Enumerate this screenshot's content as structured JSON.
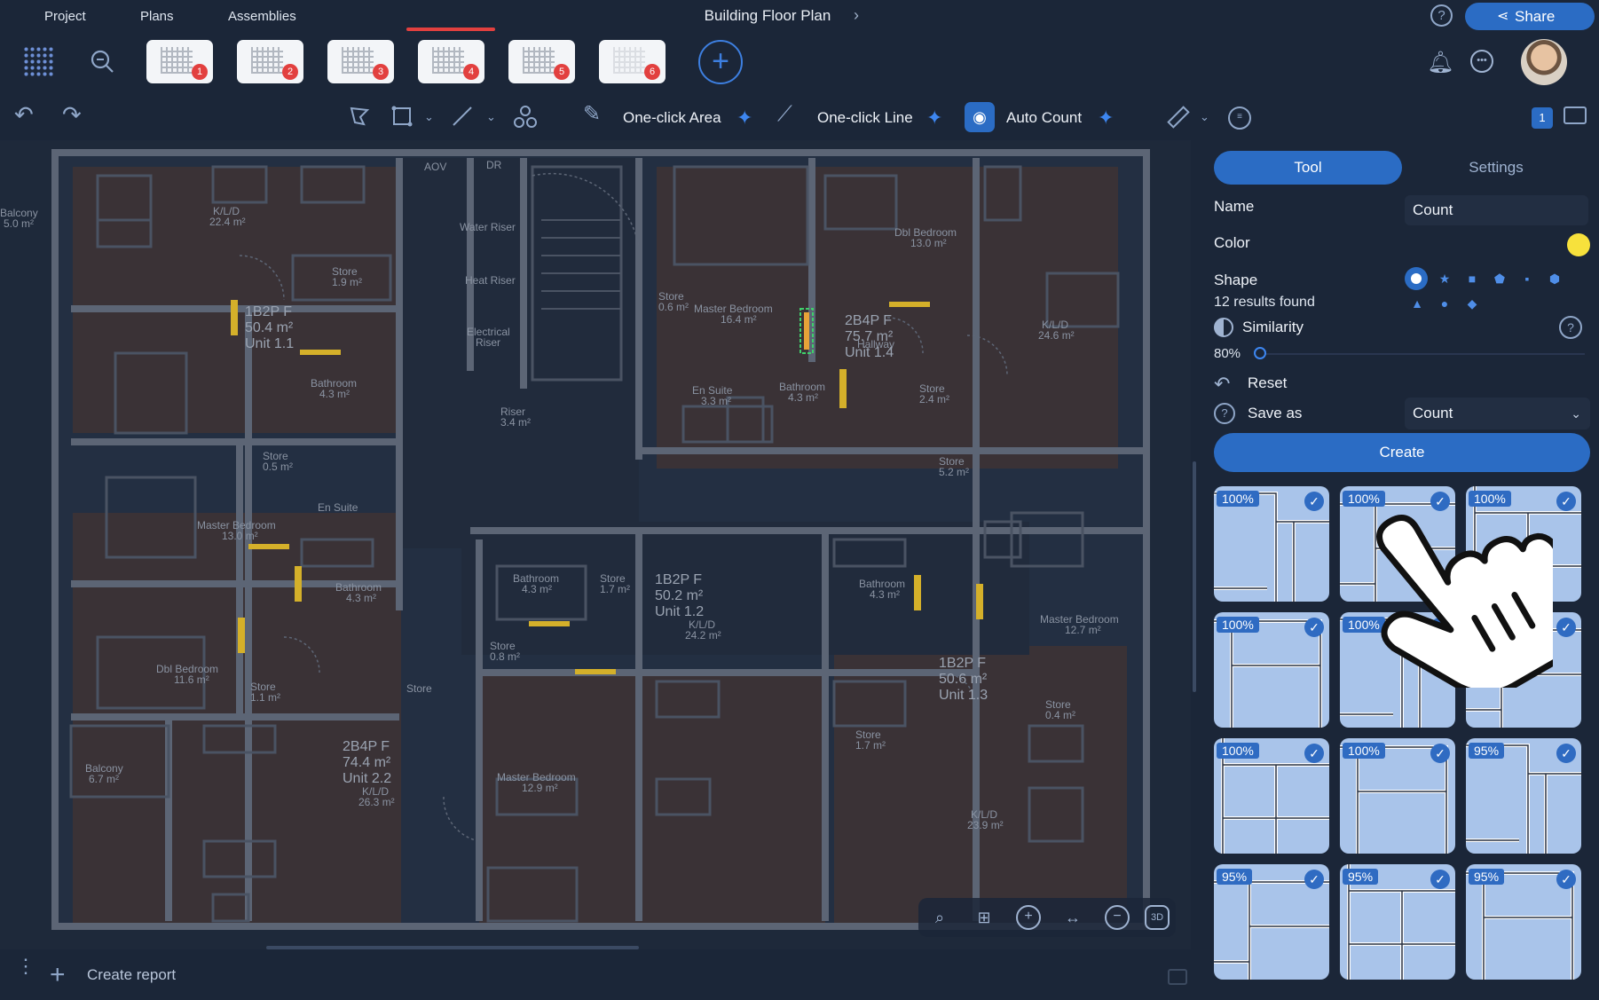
{
  "nav": {
    "tabs": [
      "Project",
      "Plans",
      "Assemblies"
    ],
    "title": "Building Floor Plan",
    "share": "Share"
  },
  "plans": {
    "thumbnails": [
      "1",
      "2",
      "3",
      "4",
      "5",
      "6"
    ],
    "active_index": 3
  },
  "toolbar": {
    "one_click_area": "One-click Area",
    "one_click_line": "One-click Line",
    "auto_count": "Auto Count",
    "page_badge": "1"
  },
  "plan": {
    "labels": {
      "aov": "AOV",
      "dr": "DR",
      "balcony_top": "Balcony",
      "balcony_top_area": "5.0 m²",
      "kld_1": "K/L/D",
      "kld_1_area": "22.4 m²",
      "store_1": "Store",
      "store_1_area": "1.9 m²",
      "bathroom_1": "Bathroom",
      "bathroom_1_area": "4.3 m²",
      "water_riser": "Water Riser",
      "heat_riser": "Heat Riser",
      "electrical_riser_1": "Electrical",
      "electrical_riser_2": "Riser",
      "riser": "Riser",
      "riser_area": "3.4 m²",
      "master_bed_top": "Master Bedroom",
      "master_bed_top_area": "16.4 m²",
      "store_top": "Store",
      "store_top_area": "0.6 m²",
      "dbl_bed_top": "Dbl Bedroom",
      "dbl_bed_top_area": "13.0 m²",
      "en_suite_top": "En Suite",
      "en_suite_top_area": "3.3 m²",
      "bath_top": "Bathroom",
      "bath_top_area": "4.3 m²",
      "hallway": "Hallway",
      "store_right": "Store",
      "store_right_area": "2.4 m²",
      "kld_right": "K/L/D",
      "kld_right_area": "24.6 m²",
      "store_mid": "Store",
      "store_mid_area": "0.5 m²",
      "en_suite_left": "En Suite",
      "master_bed_left": "Master Bedroom",
      "master_bed_left_area": "13.0 m²",
      "bathroom_left": "Bathroom",
      "bathroom_left_area": "4.3 m²",
      "dbl_bed_left": "Dbl Bedroom",
      "dbl_bed_left_area": "11.6 m²",
      "store_left": "Store",
      "store_left_area": "1.1 m²",
      "store_center": "Store",
      "balcony_bottom": "Balcony",
      "balcony_bottom_area": "6.7 m²",
      "kld_bottom": "K/L/D",
      "kld_bottom_area": "26.3 m²",
      "master_bed_bottom": "Master Bedroom",
      "master_bed_bottom_area": "12.9 m²",
      "bathroom_c": "Bathroom",
      "bathroom_c_area": "4.3 m²",
      "store_c": "Store",
      "store_c_area": "1.7 m²",
      "store_c2": "Store",
      "store_c2_area": "0.8 m²",
      "kld_c": "K/L/D",
      "kld_c_area": "24.2 m²",
      "bathroom_d": "Bathroom",
      "bathroom_d_area": "4.3 m²",
      "store_d": "Store",
      "store_d_area": "1.7 m²",
      "kld_d": "K/L/D",
      "kld_d_area": "23.9 m²",
      "master_bed_right": "Master Bedroom",
      "master_bed_right_area": "12.7 m²",
      "store_br": "Store",
      "store_br_area": "0.4 m²",
      "store_hall": "Store",
      "store_hall_area": "5.2 m²"
    },
    "units": [
      {
        "type": "1B2P F",
        "area": "50.4 m²",
        "unit": "Unit 1.1"
      },
      {
        "type": "2B4P F",
        "area": "75.7 m²",
        "unit": "Unit 1.4"
      },
      {
        "type": "1B2P F",
        "area": "50.2 m²",
        "unit": "Unit 1.2"
      },
      {
        "type": "1B2P F",
        "area": "50.6 m²",
        "unit": "Unit 1.3"
      },
      {
        "type": "2B4P F",
        "area": "74.4 m²",
        "unit": "Unit 2.2"
      }
    ]
  },
  "panel": {
    "tab_tool": "Tool",
    "tab_settings": "Settings",
    "name_label": "Name",
    "name_value": "Count",
    "color_label": "Color",
    "color_value": "#f7e13c",
    "shape_label": "Shape",
    "shapes": [
      "circle",
      "star",
      "square",
      "pentagon",
      "rounded-square",
      "hexagon",
      "triangle",
      "dot",
      "diamond"
    ],
    "results": "12 results found",
    "similarity_label": "Similarity",
    "similarity_value": "80%",
    "similarity_level": 0.0,
    "reset_label": "Reset",
    "save_as_label": "Save as",
    "save_as_value": "Count",
    "confirm_label": "Create"
  },
  "results": [
    {
      "pct": "100%",
      "checked": true
    },
    {
      "pct": "100%",
      "checked": true
    },
    {
      "pct": "100%",
      "checked": true
    },
    {
      "pct": "100%",
      "checked": true
    },
    {
      "pct": "100%",
      "checked": true
    },
    {
      "pct": "100%",
      "checked": true
    },
    {
      "pct": "100%",
      "checked": true
    },
    {
      "pct": "100%",
      "checked": true
    },
    {
      "pct": "95%",
      "checked": true
    },
    {
      "pct": "95%",
      "checked": true
    },
    {
      "pct": "95%",
      "checked": true
    },
    {
      "pct": "95%",
      "checked": true
    }
  ],
  "bottom": {
    "create_report": "Create report"
  }
}
